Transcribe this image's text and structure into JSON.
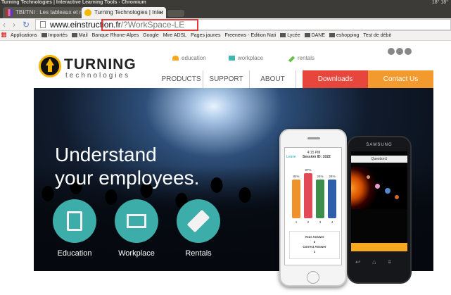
{
  "window": {
    "title": "Turning Technologies | Interactive Learning Tools - Chromium",
    "tray_text": "18°  18°"
  },
  "tabs": [
    {
      "label": "TBI/TNI : Les tableaux et mu",
      "active": false
    },
    {
      "label": "Turning Technologies | Inter",
      "active": true
    }
  ],
  "address": {
    "domain": "www.einstruction.",
    "highlight": "fr",
    "path": "/?WorkSpace-LE"
  },
  "bookmarks": [
    "Applications",
    "Importés",
    "Mail",
    "Banque Rhone-Alpes",
    "Google",
    "Mire ADSL",
    "Pages jaunes",
    "Freenews - Edition Nati",
    "Lycée",
    "DANE",
    "eshopping",
    "Test de débit"
  ],
  "site": {
    "logo_brand": "TURNING",
    "logo_sub": "technologies",
    "sectors": [
      "education",
      "workplace",
      "rentals"
    ],
    "sector_colors": [
      "#f5a623",
      "#3fb6b1",
      "#6abf4b"
    ],
    "menu": [
      "PRODUCTS",
      "SUPPORT",
      "ABOUT"
    ],
    "downloads_label": "Downloads",
    "contact_label": "Contact Us",
    "downloads_color": "#e6463b",
    "contact_color": "#f29a2e"
  },
  "hero": {
    "headline_line1": "Understand",
    "headline_line2": "your employees.",
    "categories": [
      {
        "label": "Education",
        "icon": "book-icon"
      },
      {
        "label": "Workplace",
        "icon": "presentation-board-icon"
      },
      {
        "label": "Rentals",
        "icon": "ticket-icon"
      }
    ]
  },
  "iphone": {
    "status_time": "4:15 PM",
    "level_label": "Leave",
    "session_label": "Session ID: 1022",
    "bars": [
      {
        "label": "1",
        "pct": "84%",
        "value": 84,
        "color": "#f0922b"
      },
      {
        "label": "2",
        "pct": "97%",
        "value": 97,
        "color": "#e24a55"
      },
      {
        "label": "3",
        "pct": "24%",
        "value": 84,
        "color": "#3b8f4a"
      },
      {
        "label": "4",
        "pct": "24%",
        "value": 84,
        "color": "#2f5fa8"
      }
    ],
    "your_answer_label": "Your Answer",
    "your_answer_value": "2",
    "correct_answer_label": "Correct Answer",
    "correct_answer_value": "1"
  },
  "samsung": {
    "brand": "SAMSUNG",
    "question_label": "Question1"
  }
}
